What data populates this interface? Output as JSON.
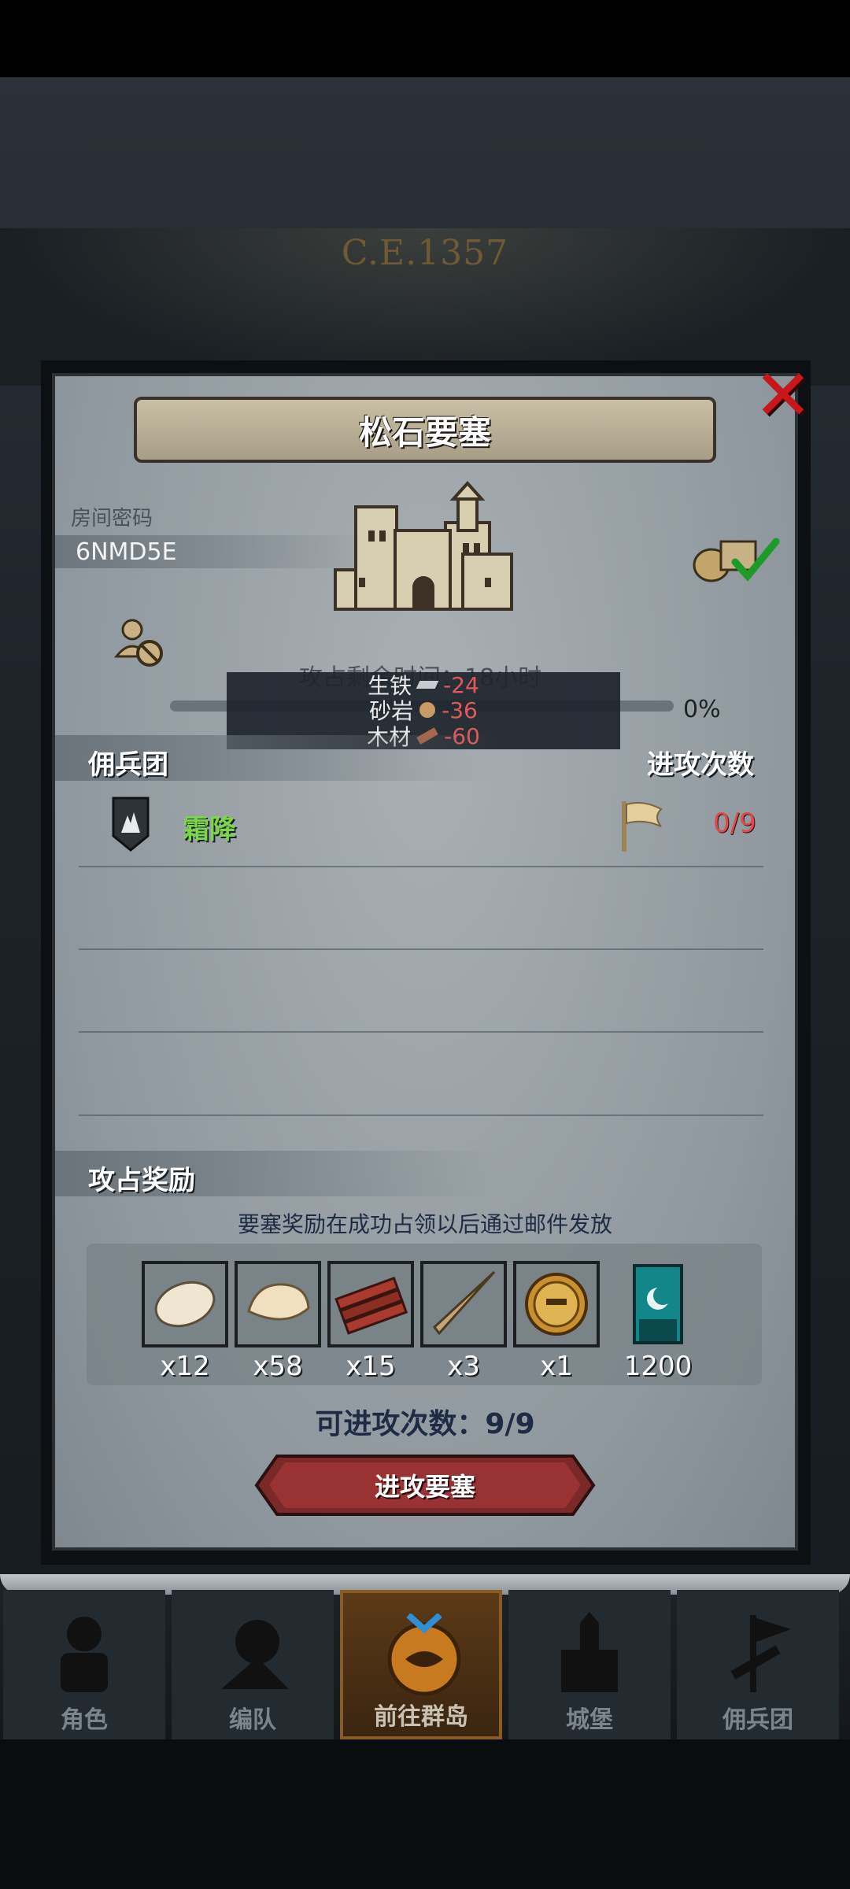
{
  "header": {
    "year": "C.E.1357"
  },
  "modal": {
    "title": "松石要塞",
    "room_password_label": "房间密码",
    "room_password": "6NMD5E",
    "timer_text": "攻占剩余时间：18小时",
    "progress_pct": "0%",
    "resource_tooltip": [
      {
        "name": "生铁",
        "icon": "iron-icon",
        "value": "-24"
      },
      {
        "name": "砂岩",
        "icon": "sandstone-icon",
        "value": "-36"
      },
      {
        "name": "木材",
        "icon": "wood-icon",
        "value": "-60"
      }
    ],
    "mercenary_section_title": "佣兵团",
    "attack_count_title": "进攻次数",
    "mercenaries": [
      {
        "name": "霜降",
        "count": "0/9",
        "icon": "frost-shield-icon"
      }
    ],
    "reward_section_title": "攻占奖励",
    "reward_note": "要塞奖励在成功占领以后通过邮件发放",
    "rewards": [
      {
        "icon": "pelt-icon",
        "qty": "x12"
      },
      {
        "icon": "fur-icon",
        "qty": "x58"
      },
      {
        "icon": "timber-icon",
        "qty": "x15"
      },
      {
        "icon": "horn-icon",
        "qty": "x3"
      },
      {
        "icon": "knight-coin-icon",
        "qty": "x1"
      },
      {
        "icon": "guild-banner-icon",
        "qty": "1200"
      }
    ],
    "attempts_text": "可进攻次数：9/9",
    "attack_button": "进攻要塞"
  },
  "nav": {
    "items": [
      {
        "label": "角色",
        "icon": "character-icon"
      },
      {
        "label": "编队",
        "icon": "formation-icon"
      },
      {
        "label": "前往群岛",
        "icon": "islands-icon",
        "active": true
      },
      {
        "label": "城堡",
        "icon": "castle-icon"
      },
      {
        "label": "佣兵团",
        "icon": "mercenary-icon"
      }
    ]
  },
  "colors": {
    "accent_red": "#e0484a",
    "merc_green": "#7dd64a",
    "title_text": "#ffffff"
  }
}
